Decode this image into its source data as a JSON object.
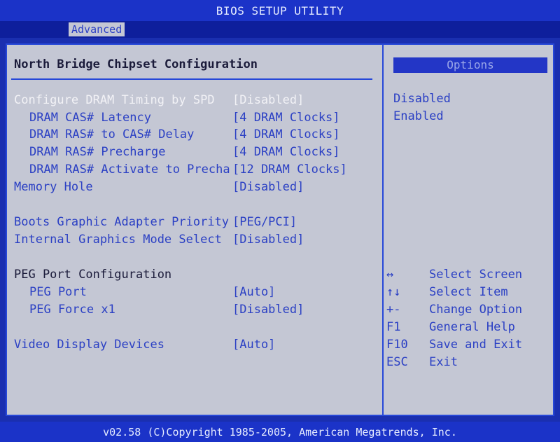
{
  "title": "BIOS SETUP UTILITY",
  "tabs": [
    {
      "label": "Advanced"
    }
  ],
  "section_title": "North Bridge Chipset Configuration",
  "settings": [
    {
      "label": "Configure DRAM Timing by SPD",
      "value": "[Disabled]"
    },
    {
      "label": "DRAM CAS# Latency",
      "value": "[4 DRAM Clocks]"
    },
    {
      "label": "DRAM RAS# to CAS# Delay",
      "value": "[4 DRAM Clocks]"
    },
    {
      "label": "DRAM RAS# Precharge",
      "value": "[4 DRAM Clocks]"
    },
    {
      "label": "DRAM RAS# Activate to Precha",
      "value": "[12 DRAM Clocks]"
    },
    {
      "label": "Memory Hole",
      "value": "[Disabled]"
    },
    {
      "label": "Boots Graphic Adapter Priority",
      "value": "[PEG/PCI]"
    },
    {
      "label": "Internal Graphics Mode Select",
      "value": "[Disabled]"
    },
    {
      "label": "PEG Port Configuration"
    },
    {
      "label": "PEG Port",
      "value": "[Auto]"
    },
    {
      "label": "PEG Force x1",
      "value": "[Disabled]"
    },
    {
      "label": "Video Display Devices",
      "value": "[Auto]"
    }
  ],
  "options": {
    "header": "Options",
    "items": [
      "Disabled",
      "Enabled"
    ]
  },
  "help": [
    {
      "key": "↔",
      "desc": "Select Screen"
    },
    {
      "key": "↑↓",
      "desc": "Select Item"
    },
    {
      "key": "+-",
      "desc": "Change Option"
    },
    {
      "key": "F1",
      "desc": "General Help"
    },
    {
      "key": "F10",
      "desc": "Save and Exit"
    },
    {
      "key": "ESC",
      "desc": "Exit"
    }
  ],
  "footer": "v02.58 (C)Copyright 1985-2005, American Megatrends, Inc.",
  "colors": {
    "background": "#1a2fb0",
    "panel": "#c4c7d4",
    "highlight_text": "#f2f2f6",
    "setting_text": "#2b40c4"
  }
}
